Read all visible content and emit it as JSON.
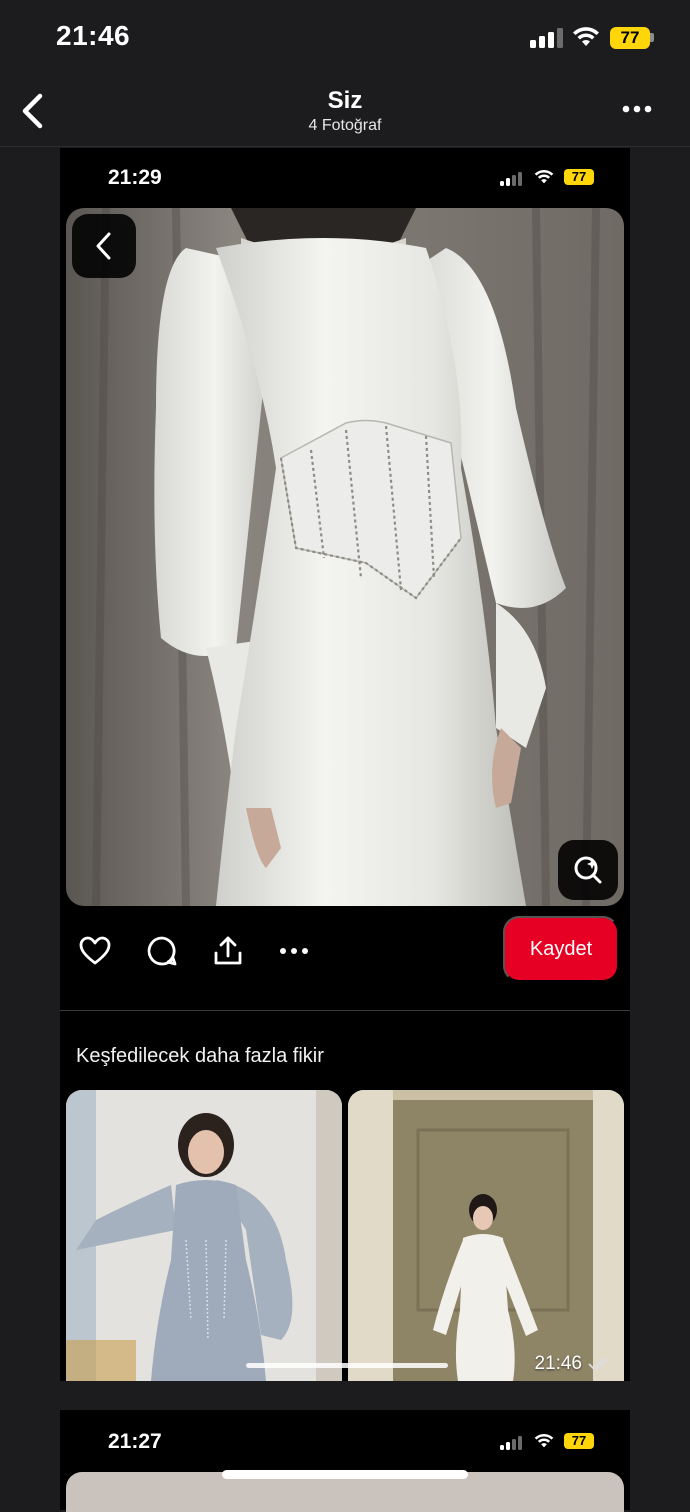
{
  "status_bar": {
    "time": "21:46",
    "battery": "77",
    "battery_color": "#ffd60a"
  },
  "nav": {
    "title": "Siz",
    "subtitle": "4 Fotoğraf"
  },
  "inner": {
    "status_time": "21:29",
    "battery": "77",
    "actions": {
      "save_label": "Kaydet",
      "save_color": "#e60023"
    },
    "more_ideas_title": "Keşfedilecek daha fazla fikir",
    "thumb_timestamp": "21:46"
  },
  "second_inner": {
    "status_time": "21:27",
    "battery": "77"
  },
  "icons": [
    "back-chevron-icon",
    "more-dots-icon",
    "heart-icon",
    "comment-icon",
    "share-icon",
    "visual-search-icon",
    "double-check-icon"
  ]
}
